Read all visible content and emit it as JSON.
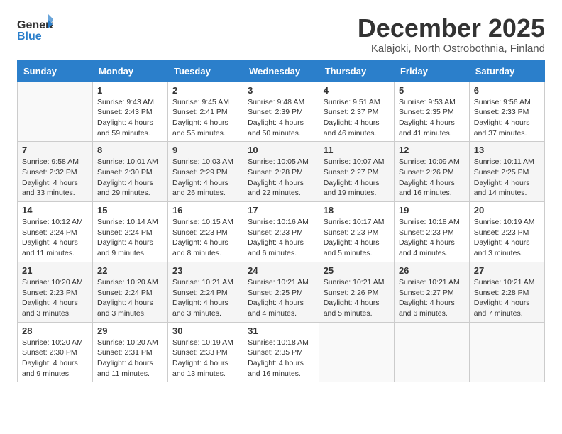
{
  "header": {
    "logo_general": "General",
    "logo_blue": "Blue",
    "month_year": "December 2025",
    "location": "Kalajoki, North Ostrobothnia, Finland"
  },
  "days_of_week": [
    "Sunday",
    "Monday",
    "Tuesday",
    "Wednesday",
    "Thursday",
    "Friday",
    "Saturday"
  ],
  "weeks": [
    [
      {
        "day": "",
        "info": ""
      },
      {
        "day": "1",
        "info": "Sunrise: 9:43 AM\nSunset: 2:43 PM\nDaylight: 4 hours\nand 59 minutes."
      },
      {
        "day": "2",
        "info": "Sunrise: 9:45 AM\nSunset: 2:41 PM\nDaylight: 4 hours\nand 55 minutes."
      },
      {
        "day": "3",
        "info": "Sunrise: 9:48 AM\nSunset: 2:39 PM\nDaylight: 4 hours\nand 50 minutes."
      },
      {
        "day": "4",
        "info": "Sunrise: 9:51 AM\nSunset: 2:37 PM\nDaylight: 4 hours\nand 46 minutes."
      },
      {
        "day": "5",
        "info": "Sunrise: 9:53 AM\nSunset: 2:35 PM\nDaylight: 4 hours\nand 41 minutes."
      },
      {
        "day": "6",
        "info": "Sunrise: 9:56 AM\nSunset: 2:33 PM\nDaylight: 4 hours\nand 37 minutes."
      }
    ],
    [
      {
        "day": "7",
        "info": "Sunrise: 9:58 AM\nSunset: 2:32 PM\nDaylight: 4 hours\nand 33 minutes."
      },
      {
        "day": "8",
        "info": "Sunrise: 10:01 AM\nSunset: 2:30 PM\nDaylight: 4 hours\nand 29 minutes."
      },
      {
        "day": "9",
        "info": "Sunrise: 10:03 AM\nSunset: 2:29 PM\nDaylight: 4 hours\nand 26 minutes."
      },
      {
        "day": "10",
        "info": "Sunrise: 10:05 AM\nSunset: 2:28 PM\nDaylight: 4 hours\nand 22 minutes."
      },
      {
        "day": "11",
        "info": "Sunrise: 10:07 AM\nSunset: 2:27 PM\nDaylight: 4 hours\nand 19 minutes."
      },
      {
        "day": "12",
        "info": "Sunrise: 10:09 AM\nSunset: 2:26 PM\nDaylight: 4 hours\nand 16 minutes."
      },
      {
        "day": "13",
        "info": "Sunrise: 10:11 AM\nSunset: 2:25 PM\nDaylight: 4 hours\nand 14 minutes."
      }
    ],
    [
      {
        "day": "14",
        "info": "Sunrise: 10:12 AM\nSunset: 2:24 PM\nDaylight: 4 hours\nand 11 minutes."
      },
      {
        "day": "15",
        "info": "Sunrise: 10:14 AM\nSunset: 2:24 PM\nDaylight: 4 hours\nand 9 minutes."
      },
      {
        "day": "16",
        "info": "Sunrise: 10:15 AM\nSunset: 2:23 PM\nDaylight: 4 hours\nand 8 minutes."
      },
      {
        "day": "17",
        "info": "Sunrise: 10:16 AM\nSunset: 2:23 PM\nDaylight: 4 hours\nand 6 minutes."
      },
      {
        "day": "18",
        "info": "Sunrise: 10:17 AM\nSunset: 2:23 PM\nDaylight: 4 hours\nand 5 minutes."
      },
      {
        "day": "19",
        "info": "Sunrise: 10:18 AM\nSunset: 2:23 PM\nDaylight: 4 hours\nand 4 minutes."
      },
      {
        "day": "20",
        "info": "Sunrise: 10:19 AM\nSunset: 2:23 PM\nDaylight: 4 hours\nand 3 minutes."
      }
    ],
    [
      {
        "day": "21",
        "info": "Sunrise: 10:20 AM\nSunset: 2:23 PM\nDaylight: 4 hours\nand 3 minutes."
      },
      {
        "day": "22",
        "info": "Sunrise: 10:20 AM\nSunset: 2:24 PM\nDaylight: 4 hours\nand 3 minutes."
      },
      {
        "day": "23",
        "info": "Sunrise: 10:21 AM\nSunset: 2:24 PM\nDaylight: 4 hours\nand 3 minutes."
      },
      {
        "day": "24",
        "info": "Sunrise: 10:21 AM\nSunset: 2:25 PM\nDaylight: 4 hours\nand 4 minutes."
      },
      {
        "day": "25",
        "info": "Sunrise: 10:21 AM\nSunset: 2:26 PM\nDaylight: 4 hours\nand 5 minutes."
      },
      {
        "day": "26",
        "info": "Sunrise: 10:21 AM\nSunset: 2:27 PM\nDaylight: 4 hours\nand 6 minutes."
      },
      {
        "day": "27",
        "info": "Sunrise: 10:21 AM\nSunset: 2:28 PM\nDaylight: 4 hours\nand 7 minutes."
      }
    ],
    [
      {
        "day": "28",
        "info": "Sunrise: 10:20 AM\nSunset: 2:30 PM\nDaylight: 4 hours\nand 9 minutes."
      },
      {
        "day": "29",
        "info": "Sunrise: 10:20 AM\nSunset: 2:31 PM\nDaylight: 4 hours\nand 11 minutes."
      },
      {
        "day": "30",
        "info": "Sunrise: 10:19 AM\nSunset: 2:33 PM\nDaylight: 4 hours\nand 13 minutes."
      },
      {
        "day": "31",
        "info": "Sunrise: 10:18 AM\nSunset: 2:35 PM\nDaylight: 4 hours\nand 16 minutes."
      },
      {
        "day": "",
        "info": ""
      },
      {
        "day": "",
        "info": ""
      },
      {
        "day": "",
        "info": ""
      }
    ]
  ]
}
